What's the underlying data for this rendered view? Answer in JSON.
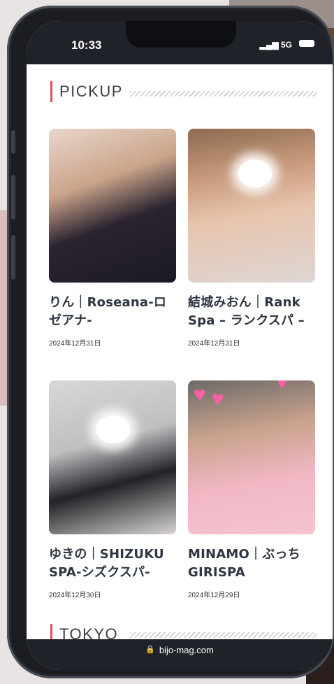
{
  "status": {
    "time": "10:33",
    "network": "5G"
  },
  "pickup": {
    "title": "PICKUP",
    "cards": [
      {
        "title": "りん｜Roseana-ロゼアナ-",
        "date": "2024年12月31日"
      },
      {
        "title": "結城みおん｜Rank Spa – ランクスパ –",
        "date": "2024年12月31日"
      },
      {
        "title": "ゆきの｜SHIZUKU SPA-シズクスパ-",
        "date": "2024年12月30日"
      },
      {
        "title": "MINAMO｜ぶっちGIRISPA",
        "date": "2024年12月29日"
      }
    ]
  },
  "tokyo": {
    "title": "TOKYO"
  },
  "browser": {
    "url": "bijo-mag.com"
  },
  "colors": {
    "accent": "#e0505c",
    "heading": "#3a3f47",
    "statusbar": "#1f2228"
  }
}
